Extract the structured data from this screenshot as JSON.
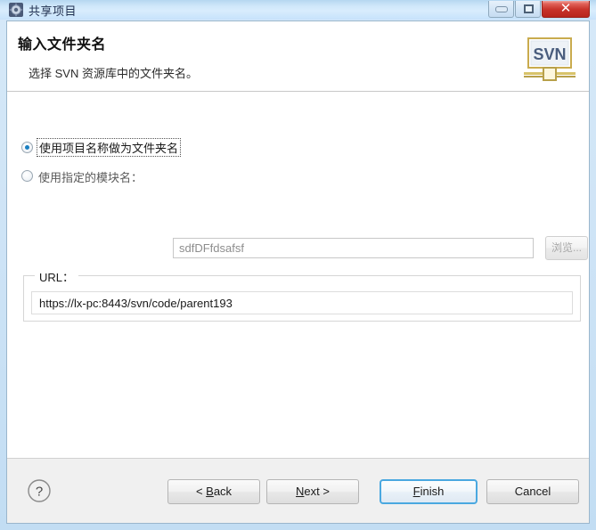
{
  "window": {
    "title": "共享项目",
    "icon": "svn-share-icon",
    "controls": {
      "minimize": {
        "name": "minimize-button",
        "glyph": "—"
      },
      "maximize": {
        "name": "maximize-button",
        "glyph": "❐"
      },
      "close": {
        "name": "close-button",
        "glyph": "✕"
      }
    }
  },
  "header": {
    "title": "输入文件夹名",
    "description": "选择 SVN 资源库中的文件夹名。",
    "logo_text": "SVN",
    "logo_name": "svn-logo"
  },
  "body": {
    "options": [
      {
        "id": "use-project-name",
        "label": "使用项目名称做为文件夹名",
        "checked": true,
        "focused": true
      },
      {
        "id": "use-specified-module",
        "label": "使用指定的模块名：",
        "checked": false,
        "focused": false
      }
    ],
    "module_input": {
      "value": "sdfDFfdsafsf",
      "placeholder": "",
      "enabled": false
    },
    "browse_button": {
      "label": "浏览...",
      "enabled": false
    },
    "url_group": {
      "legend": "URL：",
      "value": "https://lx-pc:8443/svn/code/parent193"
    }
  },
  "footer": {
    "help_label": "?",
    "buttons": [
      {
        "id": "back",
        "label": "< Back",
        "mnemonic": "B",
        "default": false
      },
      {
        "id": "next",
        "label": "Next >",
        "mnemonic": "N",
        "default": false
      },
      {
        "id": "finish",
        "label": "Finish",
        "mnemonic": "F",
        "default": true
      },
      {
        "id": "cancel",
        "label": "Cancel",
        "mnemonic": "",
        "default": false
      }
    ]
  },
  "colors": {
    "titlebar_blue": "#cfe7fa",
    "close_red": "#c8342b",
    "default_button_border": "#4aa8e0",
    "radio_dot": "#1a7fc1",
    "footer_bg": "#f0f0f0"
  }
}
